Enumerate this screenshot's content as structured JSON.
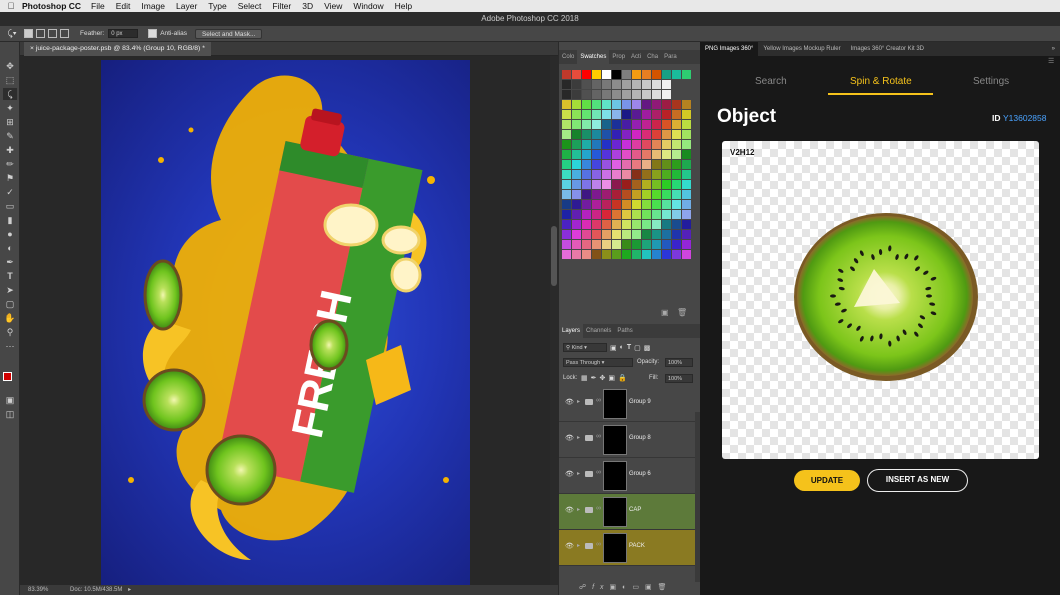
{
  "menubar": {
    "app": "Photoshop CC",
    "items": [
      "File",
      "Edit",
      "Image",
      "Layer",
      "Type",
      "Select",
      "Filter",
      "3D",
      "View",
      "Window",
      "Help"
    ]
  },
  "window_title": "Adobe Photoshop CC 2018",
  "options": {
    "feather_label": "Feather:",
    "feather_value": "0 px",
    "antialias_label": "Anti-alias",
    "select_mask_label": "Select and Mask..."
  },
  "document": {
    "tab_title": "juice-package-poster.psb @ 83.4% (Group 10, RGB/8) *",
    "zoom": "83.39%",
    "doc_info": "Doc: 10.5M/438.5M"
  },
  "poster": {
    "pack_text": "FRESH"
  },
  "swatch_tabs": [
    "Colo",
    "Swatches",
    "Prop",
    "Acti",
    "Cha",
    "Para"
  ],
  "swatch_colors": [
    "#c0392b",
    "#e74c3c",
    "#ff0000",
    "#ffcc00",
    "#ffffff",
    "#000000",
    "#7f7f7f",
    "#f39c12",
    "#e67e22",
    "#d35400",
    "#16a085",
    "#1abc9c",
    "#2ecc71",
    "#27ae60",
    "#3498db",
    "#2980b9",
    "#9b59b6",
    "#8e44ad",
    "#f1c40f",
    "#ff66cc",
    "#66ccff",
    "#ccff66",
    "#ff9966",
    "#9966ff",
    "#00ffcc",
    "#ff3366",
    "#33ff66",
    "#6633ff",
    "#cccccc",
    "#999999",
    "#666666",
    "#333333"
  ],
  "layer_tabs": [
    "Layers",
    "Channels",
    "Paths"
  ],
  "layer_filter": {
    "kind": "Kind",
    "blend_mode": "Pass Through",
    "opacity_label": "Opacity:",
    "opacity_value": "100%",
    "lock_label": "Lock:",
    "fill_label": "Fill:",
    "fill_value": "100%"
  },
  "layers": [
    {
      "name": "Group 9",
      "color": "#474747"
    },
    {
      "name": "Group 8",
      "color": "#474747"
    },
    {
      "name": "Group 6",
      "color": "#474747"
    },
    {
      "name": "CAP",
      "color": "#5d7a3a"
    },
    {
      "name": "PACK",
      "color": "#8a7a22"
    }
  ],
  "plugin_tabs": [
    "PNG Images 360°",
    "Yellow Images Mockup Ruler",
    "Images 360° Creator Kit 3D"
  ],
  "plugin": {
    "nav": [
      "Search",
      "Spin & Rotate",
      "Settings"
    ],
    "active_nav": "Spin & Rotate",
    "title": "Object",
    "id_label": "ID",
    "id_value": "Y13602858",
    "view_label": "V2H12",
    "update_label": "UPDATE",
    "insert_label": "INSERT AS NEW"
  },
  "colors": {
    "accent": "#f5c21b",
    "id_link": "#4aa3ff",
    "poster_bg": "#2236b8"
  }
}
